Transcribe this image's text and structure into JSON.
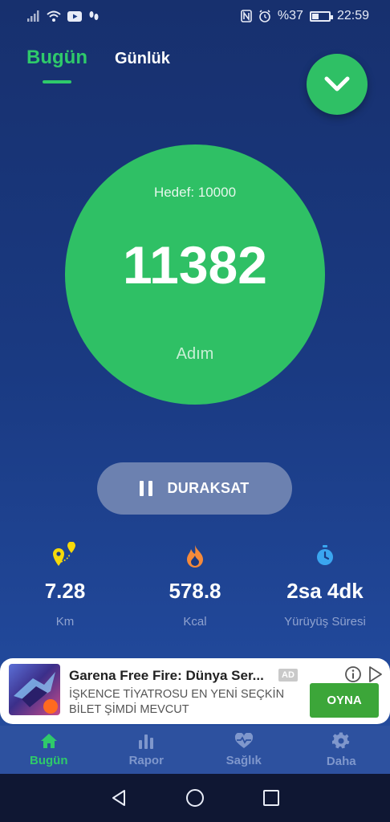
{
  "status_bar": {
    "battery_text": "%37",
    "time": "22:59",
    "battery_level": 0.37
  },
  "tabs": [
    {
      "label": "Bugün",
      "active": true
    },
    {
      "label": "Günlük",
      "active": false
    }
  ],
  "steps": {
    "goal_label": "Hedef: 10000",
    "count": "11382",
    "unit": "Adım"
  },
  "pause_button": {
    "label": "DURAKSAT"
  },
  "stats": [
    {
      "icon": "map-pins-icon",
      "value": "7.28",
      "label": "Km"
    },
    {
      "icon": "flame-icon",
      "value": "578.8",
      "label": "Kcal"
    },
    {
      "icon": "stopwatch-icon",
      "value": "2sa 4dk",
      "label": "Yürüyüş Süresi"
    }
  ],
  "ad": {
    "title": "Garena Free Fire: Dünya Ser...",
    "badge": "AD",
    "description": "İŞKENCE TİYATROSU EN YENİ SEÇKİN BİLET ŞİMDİ MEVCUT",
    "cta": "OYNA"
  },
  "bottom_nav": [
    {
      "label": "Bugün",
      "icon": "home-icon",
      "active": true
    },
    {
      "label": "Rapor",
      "icon": "bar-chart-icon",
      "active": false
    },
    {
      "label": "Sağlık",
      "icon": "heart-pulse-icon",
      "active": false
    },
    {
      "label": "Daha",
      "icon": "gear-icon",
      "active": false
    }
  ],
  "colors": {
    "accent": "#2fc065",
    "background": "#1a3a82",
    "nav": "#2d519f",
    "inactive": "#7f97cc"
  }
}
